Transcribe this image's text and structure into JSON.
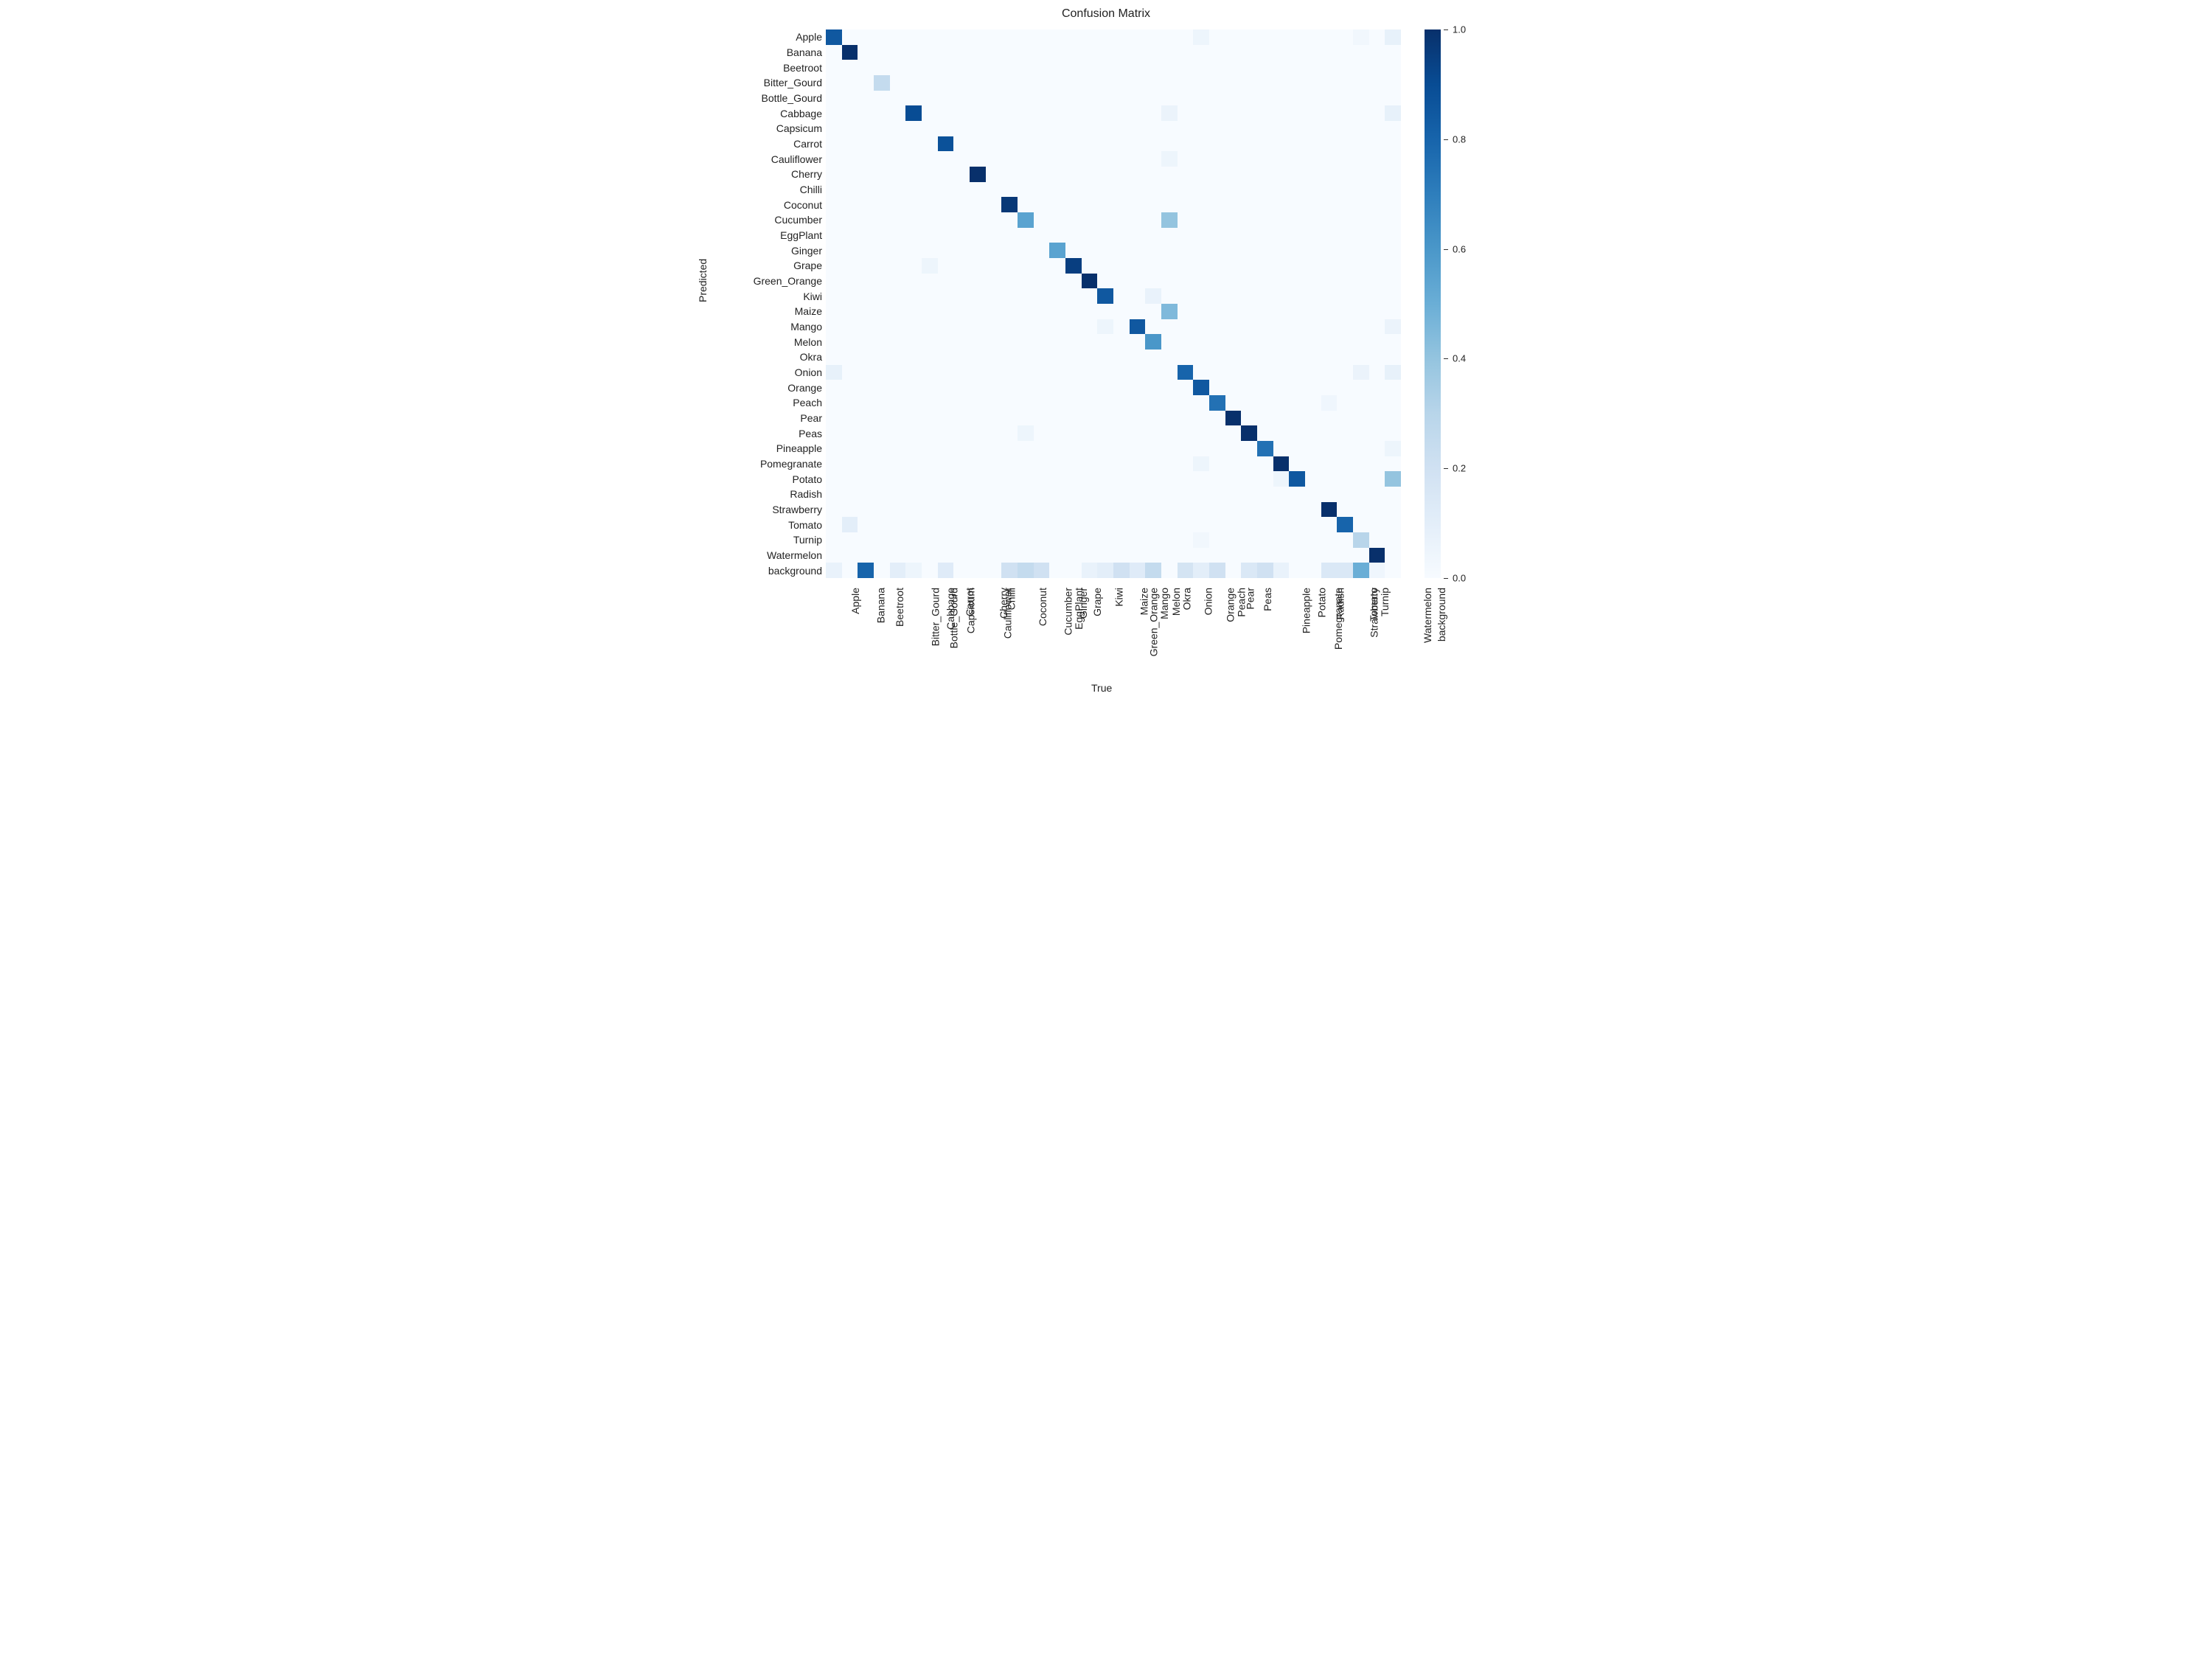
{
  "chart_data": {
    "type": "heatmap",
    "title": "Confusion Matrix",
    "xlabel": "True",
    "ylabel": "Predicted",
    "categories": [
      "Apple",
      "Banana",
      "Beetroot",
      "Bitter_Gourd",
      "Bottle_Gourd",
      "Cabbage",
      "Capsicum",
      "Carrot",
      "Cauliflower",
      "Cherry",
      "Chilli",
      "Coconut",
      "Cucumber",
      "EggPlant",
      "Ginger",
      "Grape",
      "Green_Orange",
      "Kiwi",
      "Maize",
      "Mango",
      "Melon",
      "Okra",
      "Onion",
      "Orange",
      "Peach",
      "Pear",
      "Peas",
      "Pineapple",
      "Pomegranate",
      "Potato",
      "Radish",
      "Strawberry",
      "Tomato",
      "Turnip",
      "Watermelon",
      "background"
    ],
    "colorbar_range": [
      0.0,
      1.0
    ],
    "colorbar_ticks": [
      0.0,
      0.2,
      0.4,
      0.6,
      0.8,
      1.0
    ],
    "cells": [
      [
        0,
        0,
        0.85
      ],
      [
        0,
        23,
        0.05
      ],
      [
        0,
        33,
        0.03
      ],
      [
        0,
        35,
        0.08
      ],
      [
        1,
        1,
        1.0
      ],
      [
        3,
        3,
        0.25
      ],
      [
        5,
        5,
        0.9
      ],
      [
        5,
        21,
        0.06
      ],
      [
        5,
        35,
        0.08
      ],
      [
        7,
        7,
        0.88
      ],
      [
        8,
        21,
        0.05
      ],
      [
        9,
        9,
        1.0
      ],
      [
        11,
        11,
        0.97
      ],
      [
        12,
        12,
        0.55
      ],
      [
        12,
        21,
        0.4
      ],
      [
        14,
        14,
        0.55
      ],
      [
        15,
        6,
        0.05
      ],
      [
        15,
        15,
        0.95
      ],
      [
        16,
        16,
        1.0
      ],
      [
        17,
        17,
        0.85
      ],
      [
        17,
        20,
        0.07
      ],
      [
        18,
        21,
        0.45
      ],
      [
        19,
        17,
        0.05
      ],
      [
        19,
        19,
        0.85
      ],
      [
        19,
        35,
        0.06
      ],
      [
        20,
        20,
        0.6
      ],
      [
        22,
        0,
        0.08
      ],
      [
        22,
        22,
        0.8
      ],
      [
        22,
        33,
        0.06
      ],
      [
        22,
        35,
        0.08
      ],
      [
        23,
        23,
        0.85
      ],
      [
        24,
        24,
        0.75
      ],
      [
        24,
        31,
        0.04
      ],
      [
        25,
        25,
        1.0
      ],
      [
        26,
        12,
        0.05
      ],
      [
        26,
        26,
        1.0
      ],
      [
        27,
        27,
        0.75
      ],
      [
        27,
        35,
        0.05
      ],
      [
        28,
        23,
        0.05
      ],
      [
        28,
        28,
        1.0
      ],
      [
        29,
        28,
        0.05
      ],
      [
        29,
        29,
        0.85
      ],
      [
        29,
        35,
        0.4
      ],
      [
        31,
        31,
        1.0
      ],
      [
        32,
        1,
        0.1
      ],
      [
        32,
        32,
        0.8
      ],
      [
        33,
        23,
        0.03
      ],
      [
        33,
        33,
        0.3
      ],
      [
        34,
        34,
        1.0
      ],
      [
        35,
        0,
        0.07
      ],
      [
        35,
        2,
        0.8
      ],
      [
        35,
        4,
        0.1
      ],
      [
        35,
        5,
        0.05
      ],
      [
        35,
        7,
        0.12
      ],
      [
        35,
        11,
        0.2
      ],
      [
        35,
        12,
        0.25
      ],
      [
        35,
        13,
        0.2
      ],
      [
        35,
        16,
        0.07
      ],
      [
        35,
        17,
        0.1
      ],
      [
        35,
        18,
        0.2
      ],
      [
        35,
        19,
        0.12
      ],
      [
        35,
        20,
        0.25
      ],
      [
        35,
        22,
        0.18
      ],
      [
        35,
        23,
        0.1
      ],
      [
        35,
        24,
        0.2
      ],
      [
        35,
        26,
        0.15
      ],
      [
        35,
        27,
        0.2
      ],
      [
        35,
        28,
        0.07
      ],
      [
        35,
        31,
        0.15
      ],
      [
        35,
        32,
        0.15
      ],
      [
        35,
        33,
        0.5
      ],
      [
        35,
        34,
        0.04
      ]
    ]
  }
}
